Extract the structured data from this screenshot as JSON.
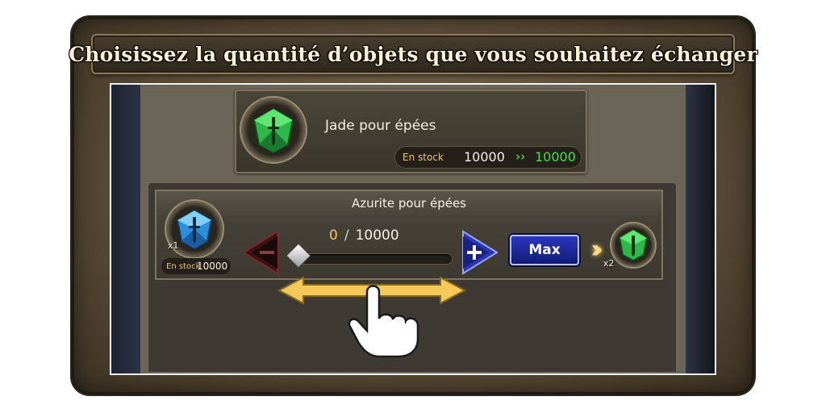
{
  "title": "Choisissez la quantité d’objets que vous souhaitez échanger",
  "item_card": {
    "name": "Jade pour épées",
    "stock_label": "En stock",
    "stock_current": "10000",
    "stock_arrows": "››",
    "stock_after": "10000"
  },
  "trade_row": {
    "name": "Azurite pour épées",
    "source_qty": "x1",
    "stock_label": "En stock",
    "stock_value": "10000",
    "counter_current": "0",
    "counter_separator": "/",
    "counter_max": "10000",
    "slider_fraction": 0,
    "max_label": "Max",
    "result_qty": "x2"
  },
  "icons": {
    "source_gem": "blue-azurite-gem-icon",
    "target_gem": "green-jade-gem-icon",
    "minus": "minus-button-icon",
    "plus": "plus-button-icon",
    "drag_hint": "pointing-hand-icon",
    "drag_arrows": "double-arrow-icon"
  },
  "colors": {
    "gold": "#e9c46a",
    "green": "#3fe43f",
    "blue_button": "#2b39c6",
    "frame": "#5c4d38"
  }
}
